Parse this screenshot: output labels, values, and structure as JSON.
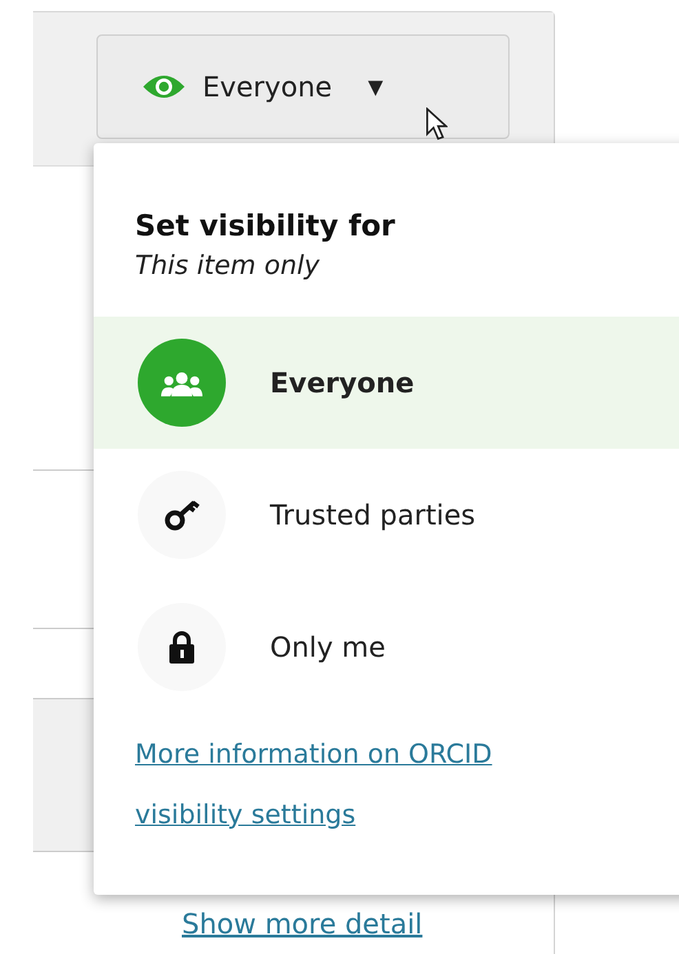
{
  "visibility_button": {
    "label": "Everyone",
    "caret": "▾"
  },
  "popup": {
    "title": "Set visibility for",
    "subtitle": "This item only",
    "options": [
      {
        "kind": "everyone",
        "label": "Everyone",
        "selected": true
      },
      {
        "kind": "trusted",
        "label": "Trusted parties",
        "selected": false
      },
      {
        "kind": "private",
        "label": "Only me",
        "selected": false
      }
    ],
    "link": "More information on ORCID visibility settings"
  },
  "page": {
    "link": "Show more detail"
  }
}
